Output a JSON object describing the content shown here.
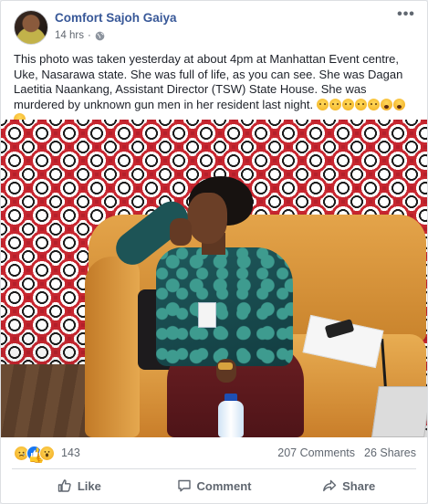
{
  "post": {
    "author": "Comfort Sajoh Gaiya",
    "time": "14 hrs",
    "time_separator": "·",
    "more_label": "•••",
    "text": "This photo was taken yesterday at about 4pm at Manhattan Event centre, Uke, Nasarawa state. She was full of life, as you can see. She was Dagan Laetitia Naankang, Assistant Director (TSW) State House. She was murdered by unknown gun men in her resident last night.",
    "text_emojis": [
      "crying-face",
      "crying-face",
      "crying-face",
      "crying-face",
      "crying-face",
      "screaming-face",
      "screaming-face",
      "screaming-face"
    ]
  },
  "footer": {
    "reactions": [
      "sad",
      "like",
      "wow"
    ],
    "reaction_count": "143",
    "comments": "207 Comments",
    "shares": "26 Shares"
  },
  "actions": {
    "like": "Like",
    "comment": "Comment",
    "share": "Share"
  },
  "colors": {
    "author_link": "#385898",
    "muted_text": "#606770",
    "like_blue": "#1877f2"
  },
  "icons": {
    "globe": "globe-icon",
    "more": "more-icon",
    "like": "thumbs-up-icon",
    "comment": "comment-bubble-icon",
    "share": "share-arrow-icon"
  }
}
